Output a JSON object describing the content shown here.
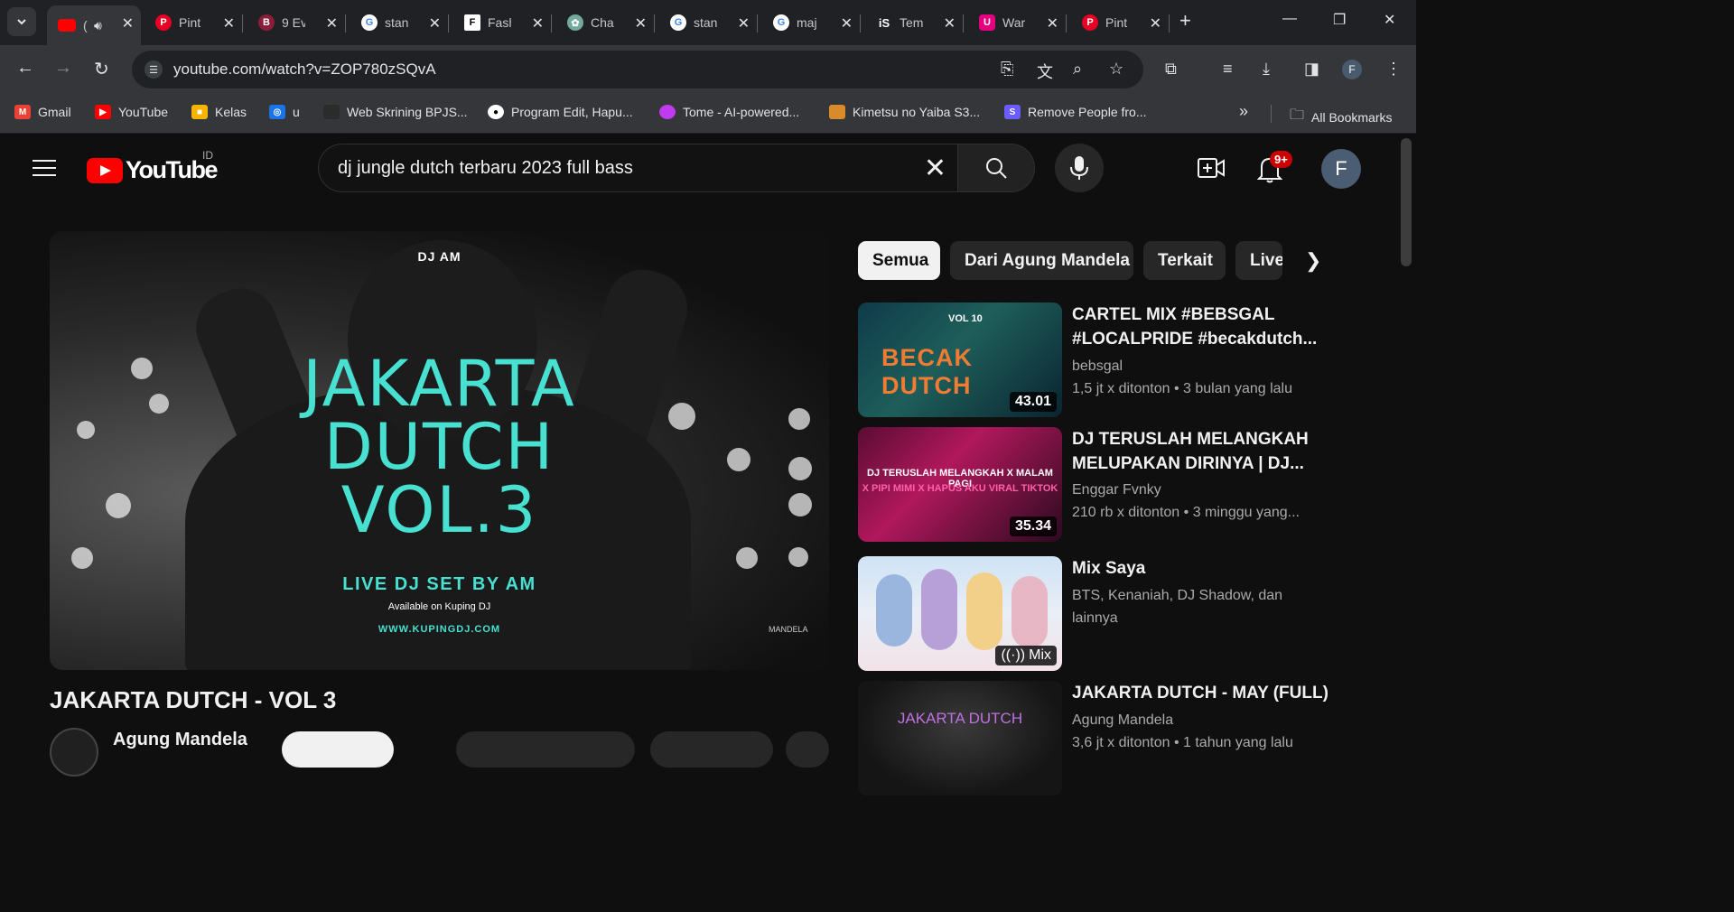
{
  "browser": {
    "tabs": [
      {
        "title": "(",
        "fav": "youtube",
        "favColor": "#ff0000",
        "active": true,
        "audio": true
      },
      {
        "title": "Pint",
        "fav": "pinterest",
        "favColor": "#e60023"
      },
      {
        "title": "9 Ev",
        "fav": "B",
        "favColor": "#8b1d3b"
      },
      {
        "title": "stan",
        "fav": "google",
        "favColor": "#ffffff"
      },
      {
        "title": "Fash",
        "fav": "fashion",
        "favColor": "#ffffff"
      },
      {
        "title": "Cha",
        "fav": "chatgpt",
        "favColor": "#74aa9c"
      },
      {
        "title": "stan",
        "fav": "google",
        "favColor": "#ffffff"
      },
      {
        "title": "maj",
        "fav": "google",
        "favColor": "#ffffff"
      },
      {
        "title": "Tem",
        "fav": "iS",
        "favColor": "#ffffff"
      },
      {
        "title": "War",
        "fav": "U",
        "favColor": "#e4007f"
      },
      {
        "title": "Pint",
        "fav": "pinterest",
        "favColor": "#e60023"
      }
    ],
    "url": "youtube.com/watch?v=ZOP780zSQvA",
    "bookmarks": [
      {
        "label": "Gmail",
        "color": "#ea4335",
        "icon": "gmail-icon"
      },
      {
        "label": "YouTube",
        "color": "#ff0000",
        "icon": "youtube-icon"
      },
      {
        "label": "Kelas",
        "color": "#f4b400",
        "icon": "classroom-icon"
      },
      {
        "label": "u",
        "color": "#1a73e8",
        "icon": "bookmark-icon"
      },
      {
        "label": "Web Skrining BPJS...",
        "color": "#2b2b2b",
        "icon": "bpjs-icon"
      },
      {
        "label": "Program Edit, Hapu...",
        "color": "#ffffff",
        "icon": "github-icon"
      },
      {
        "label": "Tome - AI-powered...",
        "color": "#c03af0",
        "icon": "tome-icon"
      },
      {
        "label": "Kimetsu no Yaiba S3...",
        "color": "#d98b2b",
        "icon": "anime-icon"
      },
      {
        "label": "Remove People fro...",
        "color": "#6b5cff",
        "icon": "remove-icon"
      }
    ],
    "more_bookmarks": "»",
    "all_bookmarks": "All Bookmarks",
    "profile_initial": "F"
  },
  "youtube": {
    "logo_text": "YouTube",
    "country": "ID",
    "search_query": "dj jungle dutch terbaru 2023 full bass",
    "notif_count": "9+",
    "avatar_initial": "F",
    "player": {
      "top_label": "DJ AM",
      "title_lines": [
        "JAKARTA",
        "DUTCH",
        "VOL.3"
      ],
      "live": "LIVE DJ SET BY AM",
      "available": "Available on Kuping DJ",
      "website": "WWW.KUPINGDJ.COM",
      "watermark": "MANDELA"
    },
    "video_title": "JAKARTA DUTCH - VOL 3",
    "channel_name": "Agung Mandela",
    "chips": [
      "Semua",
      "Dari Agung Mandela",
      "Terkait",
      "Live"
    ],
    "related": [
      {
        "title": "CARTEL MIX #BEBSGAL #LOCALPRIDE #becakdutch...",
        "channel": "bebsgal",
        "meta": "1,5 jt x ditonton  • 3 bulan yang lalu",
        "duration": "43.01",
        "thumb_text": "BECAK DUTCH",
        "thumb_sub": "VOL 10"
      },
      {
        "title": "DJ TERUSLAH MELANGKAH MELUPAKAN DIRINYA | DJ...",
        "channel": "Enggar Fvnky",
        "meta": "210 rb x ditonton  • 3 minggu yang...",
        "duration": "35.34",
        "thumb_text": "DJ TERUSLAH MELANGKAH X MALAM PAGI",
        "thumb_sub": "X PIPI MIMI X HAPUS AKU VIRAL TIKTOK"
      },
      {
        "title": "Mix Saya",
        "channel": "BTS, Kenaniah, DJ Shadow, dan lainnya",
        "meta": "",
        "duration": "Mix",
        "thumb_text": "",
        "thumb_sub": ""
      },
      {
        "title": "JAKARTA DUTCH - MAY (FULL)",
        "channel": "Agung Mandela",
        "meta": "3,6 jt x ditonton  • 1 tahun yang lalu",
        "duration": "",
        "thumb_text": "JAKARTA DUTCH",
        "thumb_sub": ""
      }
    ]
  }
}
